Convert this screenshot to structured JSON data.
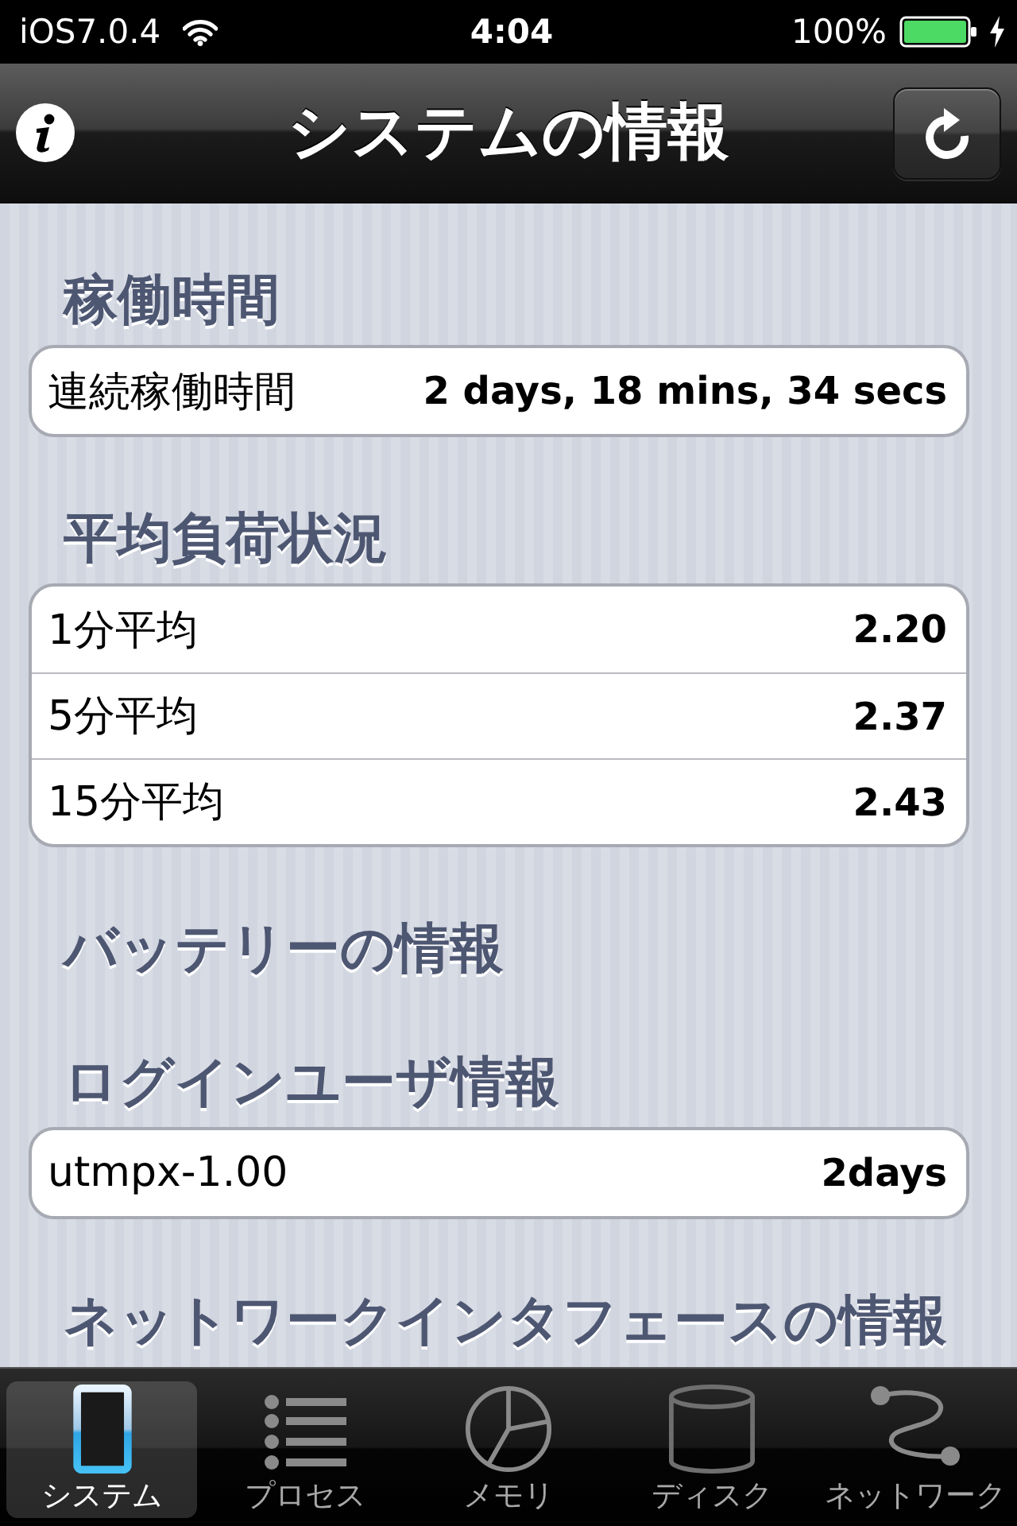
{
  "status_bar": {
    "carrier": "iOS7.0.4",
    "time": "4:04",
    "battery": "100%"
  },
  "nav_bar": {
    "title": "システムの情報"
  },
  "sections": [
    {
      "title": "稼働時間",
      "rows": [
        {
          "label": "連続稼働時間",
          "value": "2 days, 18 mins, 34 secs"
        }
      ]
    },
    {
      "title": "平均負荷状況",
      "rows": [
        {
          "label": "1分平均",
          "value": "2.20"
        },
        {
          "label": "5分平均",
          "value": "2.37"
        },
        {
          "label": "15分平均",
          "value": "2.43"
        }
      ]
    },
    {
      "title": "バッテリーの情報"
    },
    {
      "title": "ログインユーザ情報",
      "rows": [
        {
          "label": "utmpx-1.00",
          "value": "2days"
        }
      ]
    },
    {
      "title": "ネットワークインタフェースの情報"
    }
  ],
  "tab_bar": {
    "tabs": [
      {
        "label": "システム",
        "selected": true
      },
      {
        "label": "プロセス",
        "selected": false
      },
      {
        "label": "メモリ",
        "selected": false
      },
      {
        "label": "ディスク",
        "selected": false
      },
      {
        "label": "ネットワーク",
        "selected": false
      }
    ]
  }
}
